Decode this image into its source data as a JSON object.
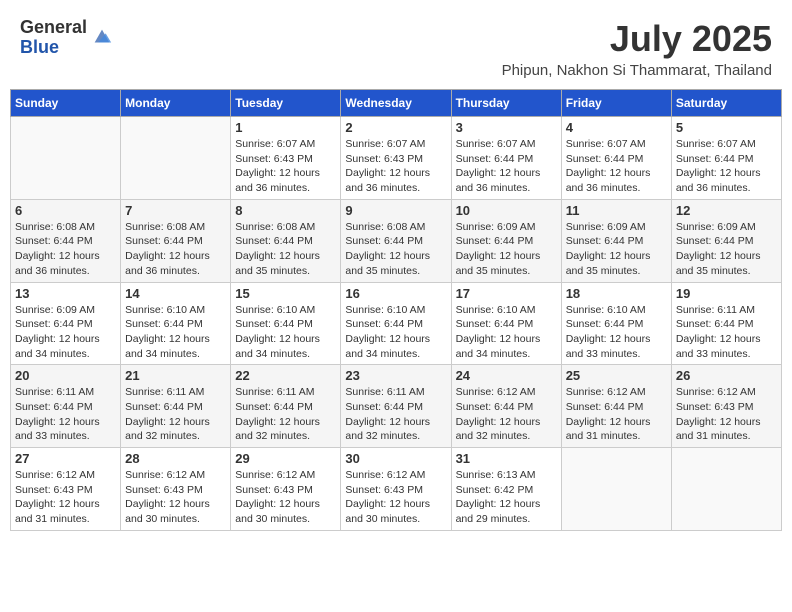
{
  "header": {
    "logo_general": "General",
    "logo_blue": "Blue",
    "month_title": "July 2025",
    "location": "Phipun, Nakhon Si Thammarat, Thailand"
  },
  "days_of_week": [
    "Sunday",
    "Monday",
    "Tuesday",
    "Wednesday",
    "Thursday",
    "Friday",
    "Saturday"
  ],
  "weeks": [
    [
      {
        "day": "",
        "sunrise": "",
        "sunset": "",
        "daylight": ""
      },
      {
        "day": "",
        "sunrise": "",
        "sunset": "",
        "daylight": ""
      },
      {
        "day": "1",
        "sunrise": "Sunrise: 6:07 AM",
        "sunset": "Sunset: 6:43 PM",
        "daylight": "Daylight: 12 hours and 36 minutes."
      },
      {
        "day": "2",
        "sunrise": "Sunrise: 6:07 AM",
        "sunset": "Sunset: 6:43 PM",
        "daylight": "Daylight: 12 hours and 36 minutes."
      },
      {
        "day": "3",
        "sunrise": "Sunrise: 6:07 AM",
        "sunset": "Sunset: 6:44 PM",
        "daylight": "Daylight: 12 hours and 36 minutes."
      },
      {
        "day": "4",
        "sunrise": "Sunrise: 6:07 AM",
        "sunset": "Sunset: 6:44 PM",
        "daylight": "Daylight: 12 hours and 36 minutes."
      },
      {
        "day": "5",
        "sunrise": "Sunrise: 6:07 AM",
        "sunset": "Sunset: 6:44 PM",
        "daylight": "Daylight: 12 hours and 36 minutes."
      }
    ],
    [
      {
        "day": "6",
        "sunrise": "Sunrise: 6:08 AM",
        "sunset": "Sunset: 6:44 PM",
        "daylight": "Daylight: 12 hours and 36 minutes."
      },
      {
        "day": "7",
        "sunrise": "Sunrise: 6:08 AM",
        "sunset": "Sunset: 6:44 PM",
        "daylight": "Daylight: 12 hours and 36 minutes."
      },
      {
        "day": "8",
        "sunrise": "Sunrise: 6:08 AM",
        "sunset": "Sunset: 6:44 PM",
        "daylight": "Daylight: 12 hours and 35 minutes."
      },
      {
        "day": "9",
        "sunrise": "Sunrise: 6:08 AM",
        "sunset": "Sunset: 6:44 PM",
        "daylight": "Daylight: 12 hours and 35 minutes."
      },
      {
        "day": "10",
        "sunrise": "Sunrise: 6:09 AM",
        "sunset": "Sunset: 6:44 PM",
        "daylight": "Daylight: 12 hours and 35 minutes."
      },
      {
        "day": "11",
        "sunrise": "Sunrise: 6:09 AM",
        "sunset": "Sunset: 6:44 PM",
        "daylight": "Daylight: 12 hours and 35 minutes."
      },
      {
        "day": "12",
        "sunrise": "Sunrise: 6:09 AM",
        "sunset": "Sunset: 6:44 PM",
        "daylight": "Daylight: 12 hours and 35 minutes."
      }
    ],
    [
      {
        "day": "13",
        "sunrise": "Sunrise: 6:09 AM",
        "sunset": "Sunset: 6:44 PM",
        "daylight": "Daylight: 12 hours and 34 minutes."
      },
      {
        "day": "14",
        "sunrise": "Sunrise: 6:10 AM",
        "sunset": "Sunset: 6:44 PM",
        "daylight": "Daylight: 12 hours and 34 minutes."
      },
      {
        "day": "15",
        "sunrise": "Sunrise: 6:10 AM",
        "sunset": "Sunset: 6:44 PM",
        "daylight": "Daylight: 12 hours and 34 minutes."
      },
      {
        "day": "16",
        "sunrise": "Sunrise: 6:10 AM",
        "sunset": "Sunset: 6:44 PM",
        "daylight": "Daylight: 12 hours and 34 minutes."
      },
      {
        "day": "17",
        "sunrise": "Sunrise: 6:10 AM",
        "sunset": "Sunset: 6:44 PM",
        "daylight": "Daylight: 12 hours and 34 minutes."
      },
      {
        "day": "18",
        "sunrise": "Sunrise: 6:10 AM",
        "sunset": "Sunset: 6:44 PM",
        "daylight": "Daylight: 12 hours and 33 minutes."
      },
      {
        "day": "19",
        "sunrise": "Sunrise: 6:11 AM",
        "sunset": "Sunset: 6:44 PM",
        "daylight": "Daylight: 12 hours and 33 minutes."
      }
    ],
    [
      {
        "day": "20",
        "sunrise": "Sunrise: 6:11 AM",
        "sunset": "Sunset: 6:44 PM",
        "daylight": "Daylight: 12 hours and 33 minutes."
      },
      {
        "day": "21",
        "sunrise": "Sunrise: 6:11 AM",
        "sunset": "Sunset: 6:44 PM",
        "daylight": "Daylight: 12 hours and 32 minutes."
      },
      {
        "day": "22",
        "sunrise": "Sunrise: 6:11 AM",
        "sunset": "Sunset: 6:44 PM",
        "daylight": "Daylight: 12 hours and 32 minutes."
      },
      {
        "day": "23",
        "sunrise": "Sunrise: 6:11 AM",
        "sunset": "Sunset: 6:44 PM",
        "daylight": "Daylight: 12 hours and 32 minutes."
      },
      {
        "day": "24",
        "sunrise": "Sunrise: 6:12 AM",
        "sunset": "Sunset: 6:44 PM",
        "daylight": "Daylight: 12 hours and 32 minutes."
      },
      {
        "day": "25",
        "sunrise": "Sunrise: 6:12 AM",
        "sunset": "Sunset: 6:44 PM",
        "daylight": "Daylight: 12 hours and 31 minutes."
      },
      {
        "day": "26",
        "sunrise": "Sunrise: 6:12 AM",
        "sunset": "Sunset: 6:43 PM",
        "daylight": "Daylight: 12 hours and 31 minutes."
      }
    ],
    [
      {
        "day": "27",
        "sunrise": "Sunrise: 6:12 AM",
        "sunset": "Sunset: 6:43 PM",
        "daylight": "Daylight: 12 hours and 31 minutes."
      },
      {
        "day": "28",
        "sunrise": "Sunrise: 6:12 AM",
        "sunset": "Sunset: 6:43 PM",
        "daylight": "Daylight: 12 hours and 30 minutes."
      },
      {
        "day": "29",
        "sunrise": "Sunrise: 6:12 AM",
        "sunset": "Sunset: 6:43 PM",
        "daylight": "Daylight: 12 hours and 30 minutes."
      },
      {
        "day": "30",
        "sunrise": "Sunrise: 6:12 AM",
        "sunset": "Sunset: 6:43 PM",
        "daylight": "Daylight: 12 hours and 30 minutes."
      },
      {
        "day": "31",
        "sunrise": "Sunrise: 6:13 AM",
        "sunset": "Sunset: 6:42 PM",
        "daylight": "Daylight: 12 hours and 29 minutes."
      },
      {
        "day": "",
        "sunrise": "",
        "sunset": "",
        "daylight": ""
      },
      {
        "day": "",
        "sunrise": "",
        "sunset": "",
        "daylight": ""
      }
    ]
  ]
}
